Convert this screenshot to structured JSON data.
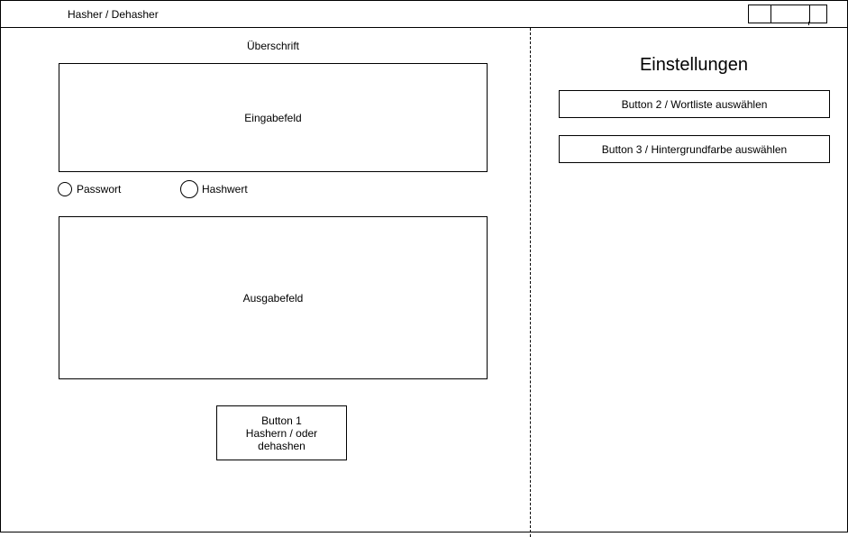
{
  "window": {
    "title": "Hasher / Dehasher"
  },
  "main": {
    "heading": "Überschrift",
    "input_field": "Eingabefeld",
    "radio_options": [
      {
        "label": "Passwort"
      },
      {
        "label": "Hashwert"
      }
    ],
    "output_field": "Ausgabefeld",
    "action_button": "Button 1 Hashern / oder dehashen"
  },
  "settings": {
    "title": "Einstellungen",
    "buttons": [
      {
        "label": "Button 2 / Wortliste auswählen"
      },
      {
        "label": "Button 3 / Hintergrundfarbe auswählen"
      }
    ]
  }
}
